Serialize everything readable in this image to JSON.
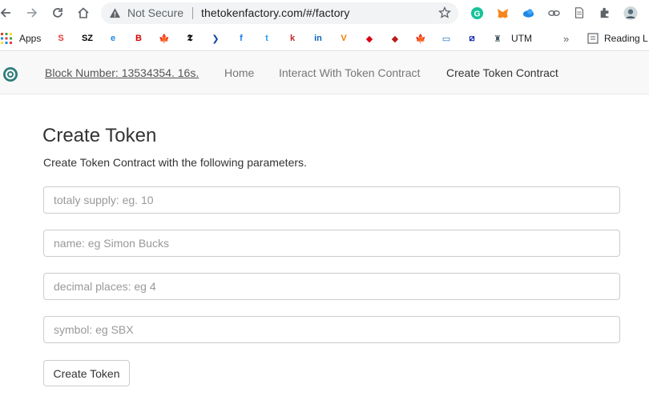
{
  "browser": {
    "security_label": "Not Secure",
    "url": "thetokenfactory.com/#/factory",
    "icons": [
      "back-icon",
      "forward-icon",
      "reload-icon",
      "home-icon",
      "warning-icon",
      "star-icon",
      "grammarly-icon",
      "metamask-icon",
      "cloud-icon",
      "link-icon",
      "document-icon",
      "extensions-icon",
      "profile-icon"
    ]
  },
  "bookmarks": {
    "apps_label": "Apps",
    "utm_label": "UTM",
    "more_label": "»",
    "reading_label": "Reading L",
    "items": [
      {
        "name": "s-bookmark",
        "glyph": "S",
        "color": "#e53935"
      },
      {
        "name": "sz-bookmark",
        "glyph": "SZ",
        "color": "#000000"
      },
      {
        "name": "edge-bookmark",
        "glyph": "e",
        "color": "#1e88e5"
      },
      {
        "name": "bild-bookmark",
        "glyph": "B",
        "color": "#d50000"
      },
      {
        "name": "maple-bookmark",
        "glyph": "🍁",
        "color": "#d50000"
      },
      {
        "name": "nyt-bookmark",
        "glyph": "𝕿",
        "color": "#000000"
      },
      {
        "name": "arrow-bookmark",
        "glyph": "❯",
        "color": "#0d47a1"
      },
      {
        "name": "facebook-bookmark",
        "glyph": "f",
        "color": "#1877f2"
      },
      {
        "name": "twitter-bookmark",
        "glyph": "t",
        "color": "#1da1f2"
      },
      {
        "name": "k-bookmark",
        "glyph": "k",
        "color": "#c62828"
      },
      {
        "name": "linkedin-bookmark",
        "glyph": "in",
        "color": "#0a66c2"
      },
      {
        "name": "v-bookmark",
        "glyph": "V",
        "color": "#f57c00"
      },
      {
        "name": "hsbc-bookmark",
        "glyph": "◆",
        "color": "#db0011"
      },
      {
        "name": "diamond-bookmark",
        "glyph": "◆",
        "color": "#b71c1c"
      },
      {
        "name": "maple2-bookmark",
        "glyph": "🍁",
        "color": "#d50000"
      },
      {
        "name": "bank-bookmark",
        "glyph": "▭",
        "color": "#1565c0"
      },
      {
        "name": "deutsche-bookmark",
        "glyph": "⧄",
        "color": "#0018a8"
      },
      {
        "name": "utm-bookmark",
        "glyph": "♜",
        "color": "#455a64"
      }
    ]
  },
  "navbar": {
    "block_label": "Block Number: 13534354. 16s.",
    "home_label": "Home",
    "interact_label": "Interact With Token Contract",
    "create_label": "Create Token Contract"
  },
  "main": {
    "title": "Create Token",
    "subtitle": "Create Token Contract with the following parameters.",
    "fields": [
      {
        "name": "total-supply-input",
        "value": "",
        "placeholder": "totaly supply: eg. 10"
      },
      {
        "name": "name-input",
        "value": "",
        "placeholder": "name: eg Simon Bucks"
      },
      {
        "name": "decimal-places-input",
        "value": "",
        "placeholder": "decimal places: eg 4"
      },
      {
        "name": "symbol-input",
        "value": "",
        "placeholder": "symbol: eg SBX"
      }
    ],
    "submit_label": "Create Token"
  }
}
